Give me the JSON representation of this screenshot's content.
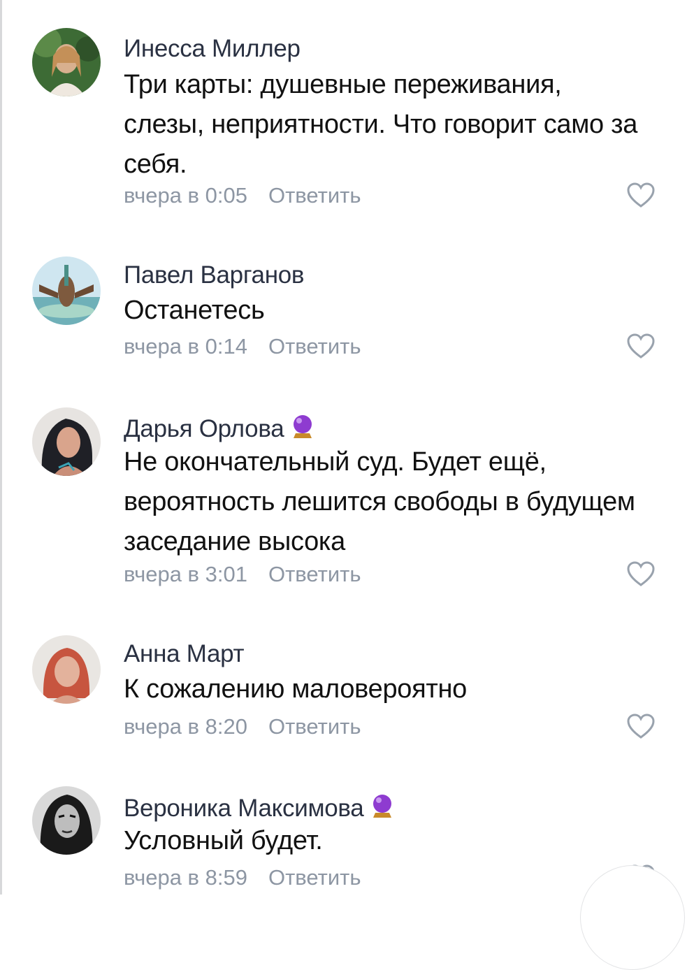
{
  "comments": [
    {
      "author": "Инесса Миллер",
      "crystal_icon": false,
      "text": "Три карты:  душевные переживания, слезы, неприятности.   Что говорит само за себя.",
      "time": "вчера в 0:05",
      "reply_label": "Ответить",
      "avatar_colors": [
        "#3d6b35",
        "#c9a27e"
      ]
    },
    {
      "author": "Павел Варганов",
      "crystal_icon": false,
      "text": "Останетесь",
      "time": "вчера в 0:14",
      "reply_label": "Ответить",
      "avatar_colors": [
        "#cfe6f0",
        "#4a8f86"
      ]
    },
    {
      "author": "Дарья Орлова",
      "crystal_icon": true,
      "text": "Не окончательный суд. Будет ещё, вероятность лешится свободы в будущем заседание высока",
      "time": "вчера в 3:01",
      "reply_label": "Ответить",
      "avatar_colors": [
        "#2a2c33",
        "#d9a48c"
      ]
    },
    {
      "author": "Анна Март",
      "crystal_icon": true,
      "text": "К сожалению маловероятно",
      "time": "вчера в 8:20",
      "reply_label": "Ответить",
      "avatar_colors": [
        "#e9e6e2",
        "#c7553f"
      ]
    },
    {
      "author": "Вероника Максимова",
      "crystal_icon": true,
      "text": "Условный будет.",
      "time": "вчера в 8:59",
      "reply_label": "Ответить",
      "avatar_colors": [
        "#1a1a1a",
        "#bdbdbd"
      ]
    }
  ],
  "icons": {
    "like": "heart-outline-icon",
    "badge": "crystal-ball-icon"
  },
  "colors": {
    "author": "#2a3142",
    "text": "#111111",
    "meta": "#8d96a3",
    "like_outline": "#99a2ad",
    "badge": "#8e3bd0"
  }
}
